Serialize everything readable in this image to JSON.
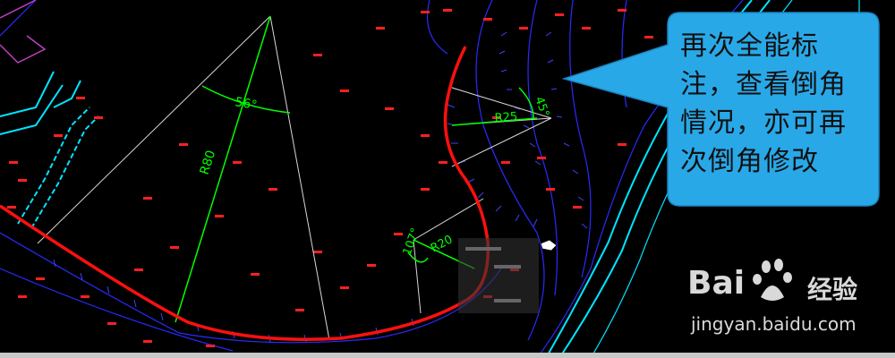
{
  "annotation": {
    "callout_text": "再次全能标注，查看倒角情况，亦可再次倒角修改"
  },
  "dimensions": {
    "angle_top": "56°",
    "radius_big": "R80",
    "radius_small_top": "R25",
    "angle_small_top": "45°",
    "radius_bottom": "R20",
    "angle_bottom": "107°"
  },
  "watermark": {
    "brand": "Bai",
    "brand_cn": "经验",
    "url": "jingyan.baidu.com"
  },
  "colors": {
    "background": "#000000",
    "curve": "#ff0000",
    "dimension": "#00ff00",
    "road": "#00e5ff",
    "callout": "#29a8e8",
    "blue_lines": "#2a2aff"
  }
}
